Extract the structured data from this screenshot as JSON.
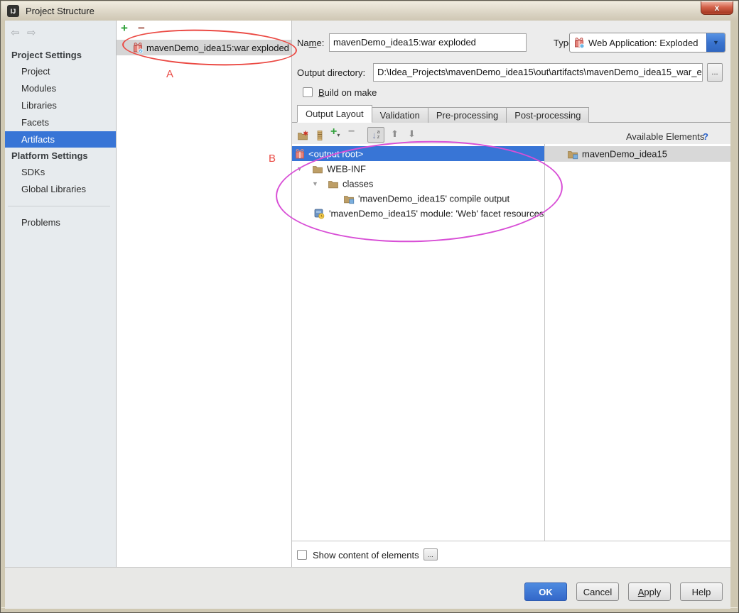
{
  "window": {
    "title": "Project Structure",
    "close": "x",
    "app_logo_text": "IJ"
  },
  "colors": {
    "selection_blue": "#3875D6",
    "annotation_red": "#EB4A44",
    "annotation_magenta": "#D84FD6",
    "ok_button_blue": "#3B77D9"
  },
  "sidebar": {
    "project_settings_header": "Project Settings",
    "project": "Project",
    "modules": "Modules",
    "libraries": "Libraries",
    "facets": "Facets",
    "artifacts": "Artifacts",
    "platform_settings_header": "Platform Settings",
    "sdks": "SDKs",
    "global_libraries": "Global Libraries",
    "problems": "Problems",
    "selected_item": "Artifacts"
  },
  "artifact_list": {
    "add": "+",
    "remove": "−",
    "selected_item": "mavenDemo_idea15:war exploded"
  },
  "annotations": {
    "label_a": "A",
    "label_b": "B"
  },
  "form": {
    "name_label_pre": "Na",
    "name_label_mn": "m",
    "name_label_post": "e:",
    "name_value": "mavenDemo_idea15:war exploded",
    "type_label": "Type:",
    "type_value": "Web Application: Exploded",
    "dd_arrow": "▼",
    "output_dir_label": "Output directory:",
    "output_dir_value": "D:\\Idea_Projects\\mavenDemo_idea15\\out\\artifacts\\mavenDemo_idea15_war_e",
    "browse": "...",
    "build_mn": "B",
    "build_post": "uild on make"
  },
  "tabs": {
    "t0": "Output Layout",
    "t1": "Validation",
    "t2": "Pre-processing",
    "t3": "Post-processing",
    "active_tab": "Output Layout"
  },
  "layout_toolbar": {
    "add": "+",
    "add_caret": "▾",
    "remove": "−",
    "sort_arrow": "↓",
    "sort_a": "a",
    "sort_z": "z",
    "move_up": "⬆",
    "move_down": "⬇"
  },
  "available": {
    "header": "Available Elements",
    "help": "?",
    "item0": "mavenDemo_idea15"
  },
  "tree": {
    "r0": "<output root>",
    "r1": "WEB-INF",
    "r2": "classes",
    "r3": "'mavenDemo_idea15' compile output",
    "r4": "'mavenDemo_idea15' module: 'Web' facet resources",
    "twisty": "▼",
    "selected_row": "<output root>"
  },
  "footer": {
    "show_content_label": "Show content of elements",
    "browse": "...",
    "ok": "OK",
    "cancel": "Cancel",
    "apply_mn": "A",
    "apply_post": "pply",
    "help": "Help"
  },
  "nav": {
    "back": "⇦",
    "forward": "⇨"
  }
}
